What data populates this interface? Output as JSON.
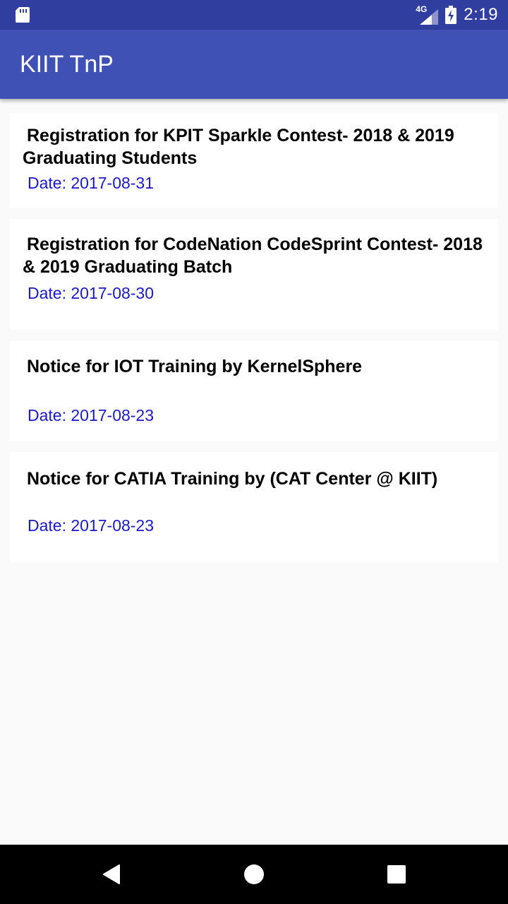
{
  "status_bar": {
    "network": "4G",
    "time": "2:19"
  },
  "app_bar": {
    "title": "KIIT TnP"
  },
  "notices": [
    {
      "title": "Registration for KPIT Sparkle Contest- 2018 & 2019 Graduating Students",
      "date": "Date: 2017-08-31"
    },
    {
      "title": "Registration for CodeNation CodeSprint Contest- 2018 & 2019 Graduating Batch",
      "date": "Date: 2017-08-30"
    },
    {
      "title": "Notice for IOT Training by KernelSphere",
      "date": "Date: 2017-08-23"
    },
    {
      "title": "Notice for CATIA Training by (CAT Center @ KIIT)",
      "date": "Date: 2017-08-23"
    }
  ],
  "nav": {
    "back_icon": "back-triangle-icon",
    "home_icon": "home-circle-icon",
    "recents_icon": "recents-square-icon"
  },
  "colors": {
    "status_bar": "#303f9f",
    "app_bar": "#3f51b5",
    "date_text": "#1a1acd",
    "background": "#fafafa"
  }
}
